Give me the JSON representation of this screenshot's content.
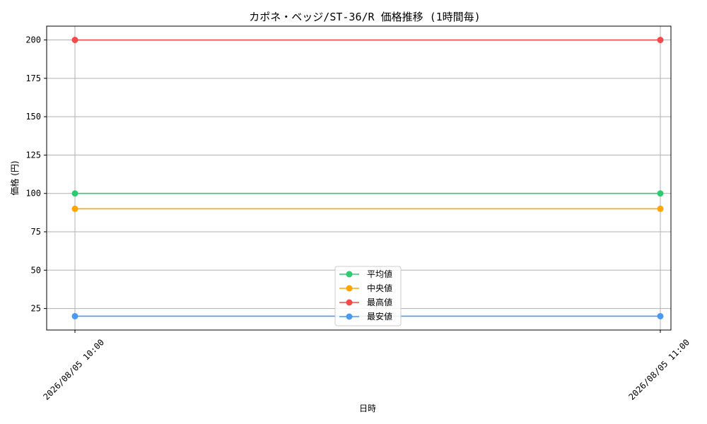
{
  "chart_data": {
    "type": "line",
    "title": "カポネ・ベッジ/ST-36/R 価格推移 (1時間毎)",
    "xlabel": "日時",
    "ylabel": "価格 (円)",
    "x": [
      "2026/08/05 10:00",
      "2026/08/05 11:00"
    ],
    "ylim": [
      11,
      209
    ],
    "yticks": [
      25,
      50,
      75,
      100,
      125,
      150,
      175,
      200
    ],
    "grid": true,
    "legend_position": "bottom-center",
    "series": [
      {
        "name": "平均値",
        "color": "#2ecc71",
        "values": [
          100,
          100
        ]
      },
      {
        "name": "中央値",
        "color": "#ffa500",
        "values": [
          90,
          90
        ]
      },
      {
        "name": "最高値",
        "color": "#f44a4a",
        "values": [
          200,
          200
        ]
      },
      {
        "name": "最安値",
        "color": "#4a9af4",
        "values": [
          20,
          20
        ]
      }
    ]
  }
}
